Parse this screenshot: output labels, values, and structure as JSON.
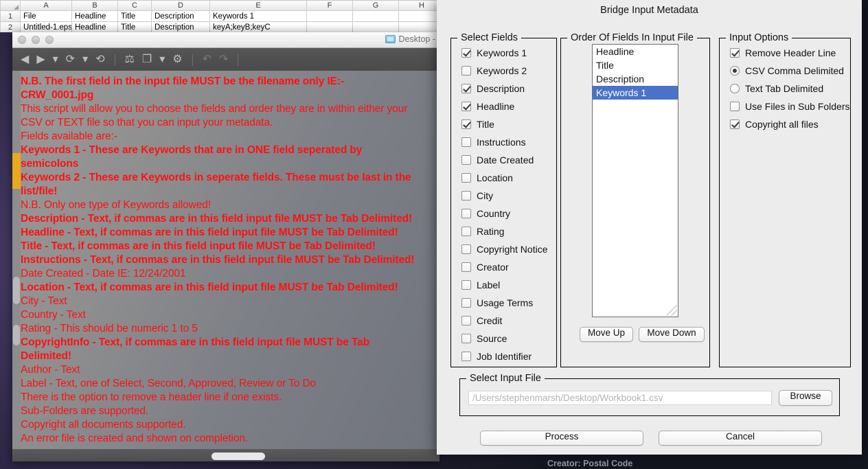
{
  "spreadsheet": {
    "column_headers": [
      "A",
      "B",
      "C",
      "D",
      "E",
      "F",
      "G",
      "H"
    ],
    "row_numbers": [
      "1",
      "2"
    ],
    "rows": [
      [
        "File",
        "Headline",
        "Title",
        "Description",
        "Keywords 1",
        "",
        "",
        ""
      ],
      [
        "Untitled-1.eps",
        "Headline",
        "Title",
        "Description",
        "keyA;keyB;keyC",
        "",
        "",
        ""
      ]
    ]
  },
  "app_window": {
    "title": "Desktop -",
    "folder_icon": "folder-icon",
    "toolbar_icons": [
      "back-arrow-icon",
      "forward-arrow-icon",
      "chevron-down-icon",
      "rotate-left-icon",
      "rotate-dropdown-icon",
      "rotate-right-icon",
      "get-photos-icon",
      "copy-icon",
      "copy-dropdown-icon",
      "refresh-icon",
      "undo-icon",
      "redo-icon"
    ],
    "document_lines": [
      {
        "text": "N.B. The first field in the input file MUST be the filename only IE:-",
        "bold": true
      },
      {
        "text": "CRW_0001.jpg",
        "bold": true
      },
      {
        "text": "This script will allow you to choose the fields and order they are in within either your",
        "bold": false
      },
      {
        "text": "CSV or TEXT file so that you can input your metadata.",
        "bold": false
      },
      {
        "text": "Fields available are:-",
        "bold": false
      },
      {
        "text": "Keywords 1 - These are Keywords that are in ONE field seperated by",
        "bold": true
      },
      {
        "text": "semicolons",
        "bold": true
      },
      {
        "text": "Keywords 2 - These are Keywords in seperate fields. These must be last in the",
        "bold": true
      },
      {
        "text": "list/file!",
        "bold": true
      },
      {
        "text": "N.B. Only one type of Keywords allowed!",
        "bold": false
      },
      {
        "text": "Description - Text, if commas are in this field input file MUST be Tab Delimited!",
        "bold": true
      },
      {
        "text": "Headline - Text, if commas are in this field input file MUST be Tab Delimited!",
        "bold": true
      },
      {
        "text": "Title - Text, if commas are in this field input file MUST be Tab Delimited!",
        "bold": true
      },
      {
        "text": "Instructions - Text, if commas are in this field input file MUST be Tab Delimited!",
        "bold": true
      },
      {
        "text": "Date Created - Date IE: 12/24/2001",
        "bold": false
      },
      {
        "text": "Location - Text, if commas are in this field input file MUST be Tab Delimited!",
        "bold": true
      },
      {
        "text": "City - Text",
        "bold": false
      },
      {
        "text": "Country - Text",
        "bold": false
      },
      {
        "text": "Rating - This should be numeric 1 to 5",
        "bold": false
      },
      {
        "text": "CopyrightInfo - Text, if commas are in this field input file MUST be Tab",
        "bold": true
      },
      {
        "text": "Delimited!",
        "bold": true
      },
      {
        "text": "Author - Text",
        "bold": false
      },
      {
        "text": "Label - Text, one of Select, Second, Approved, Review or To Do",
        "bold": false
      },
      {
        "text": "There is the option to remove a header line if one exists.",
        "bold": false
      },
      {
        "text": "Sub-Folders are supported.",
        "bold": false
      },
      {
        "text": "Copyright all documents supported.",
        "bold": false
      },
      {
        "text": "An error file is created and shown on completion.",
        "bold": false
      }
    ],
    "background_label": "Creator: Postal Code"
  },
  "dialog": {
    "title": "Bridge Input Metadata",
    "select_fields": {
      "legend": "Select Fields",
      "items": [
        {
          "label": "Keywords 1",
          "checked": true
        },
        {
          "label": "Keywords 2",
          "checked": false
        },
        {
          "label": "Description",
          "checked": true
        },
        {
          "label": "Headline",
          "checked": true
        },
        {
          "label": "Title",
          "checked": true
        },
        {
          "label": "Instructions",
          "checked": false
        },
        {
          "label": "Date Created",
          "checked": false
        },
        {
          "label": "Location",
          "checked": false
        },
        {
          "label": "City",
          "checked": false
        },
        {
          "label": "Country",
          "checked": false
        },
        {
          "label": "Rating",
          "checked": false
        },
        {
          "label": "Copyright Notice",
          "checked": false
        },
        {
          "label": "Creator",
          "checked": false
        },
        {
          "label": "Label",
          "checked": false
        },
        {
          "label": "Usage Terms",
          "checked": false
        },
        {
          "label": "Credit",
          "checked": false
        },
        {
          "label": "Source",
          "checked": false
        },
        {
          "label": "Job Identifier",
          "checked": false
        }
      ]
    },
    "order_fields": {
      "legend": "Order Of Fields In Input File",
      "items": [
        {
          "label": "Headline",
          "selected": false
        },
        {
          "label": "Title",
          "selected": false
        },
        {
          "label": "Description",
          "selected": false
        },
        {
          "label": "Keywords 1",
          "selected": true
        }
      ],
      "move_up_label": "Move Up",
      "move_down_label": "Move Down",
      "selection_color": "#4a72c8"
    },
    "input_options": {
      "legend": "Input Options",
      "items": [
        {
          "label": "Remove Header Line",
          "type": "checkbox",
          "checked": true
        },
        {
          "label": "CSV Comma Delimited",
          "type": "radio",
          "checked": true
        },
        {
          "label": "Text Tab Delimited",
          "type": "radio",
          "checked": false
        },
        {
          "label": "Use Files in Sub Folders",
          "type": "checkbox",
          "checked": false
        },
        {
          "label": "Copyright all files",
          "type": "checkbox",
          "checked": true
        }
      ]
    },
    "select_input_file": {
      "legend": "Select Input File",
      "path_placeholder": "/Users/stephenmarsh/Desktop/Workbook1.csv",
      "browse_label": "Browse"
    },
    "process_label": "Process",
    "cancel_label": "Cancel"
  }
}
